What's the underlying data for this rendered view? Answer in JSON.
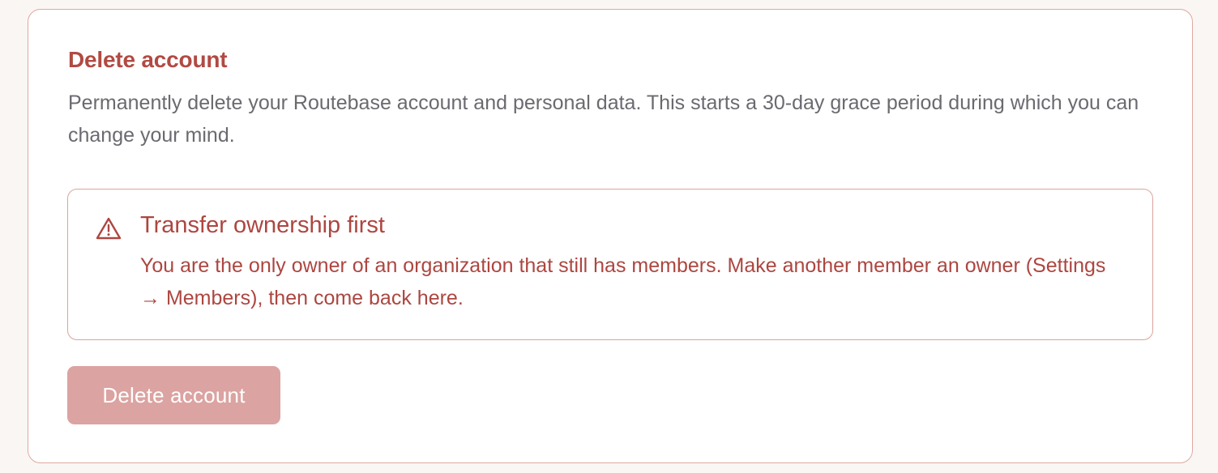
{
  "delete_section": {
    "title": "Delete account",
    "description": "Permanently delete your Routebase account and personal data. This starts a 30-day grace period during which you can change your mind."
  },
  "alert": {
    "icon": "warning-triangle-icon",
    "title": "Transfer ownership first",
    "body": "You are the only owner of an organization that still has members. Make another member an owner (Settings → Members), then come back here."
  },
  "actions": {
    "delete_label": "Delete account",
    "delete_disabled": true
  },
  "colors": {
    "danger_text": "#b14a43",
    "border": "#dfa9a0",
    "disabled_button": "#dba3a1",
    "muted_text": "#6a6a70"
  }
}
